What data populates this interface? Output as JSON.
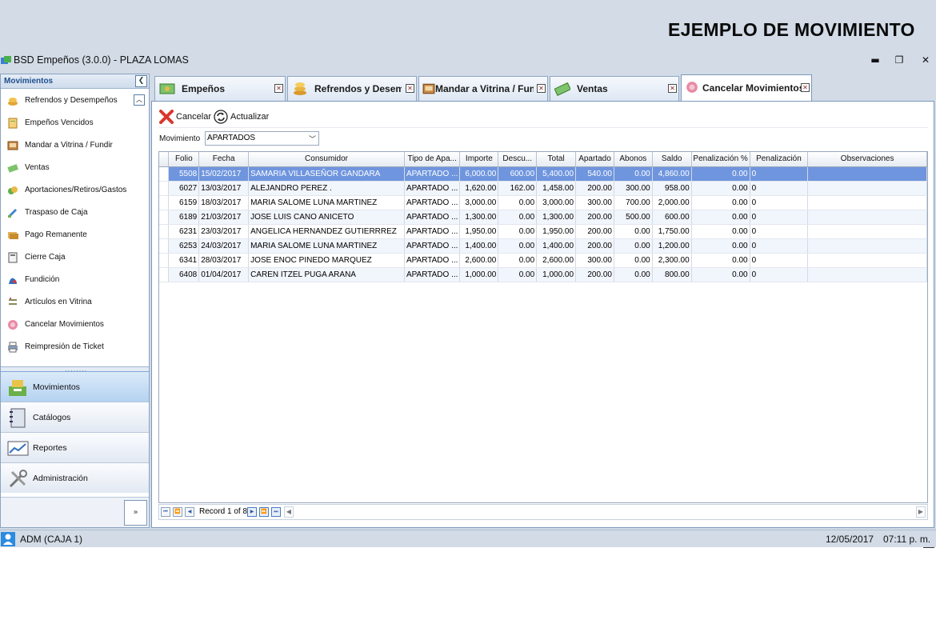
{
  "banner": {
    "title": "EJEMPLO DE MOVIMIENTO"
  },
  "window": {
    "title": "BSD Empeños (3.0.0) - PLAZA LOMAS",
    "minimize": "▬",
    "restore": "❐",
    "close": "✕"
  },
  "nav": {
    "header": "Movimientos",
    "items": [
      {
        "label": "Refrendos y Desempeños",
        "icon": "coins-icon"
      },
      {
        "label": "Empeños Vencidos",
        "icon": "document-icon"
      },
      {
        "label": "Mandar a Vitrina / Fundir",
        "icon": "showcase-icon"
      },
      {
        "label": "Ventas",
        "icon": "money-icon"
      },
      {
        "label": "Aportaciones/Retiros/Gastos",
        "icon": "coins-green-icon"
      },
      {
        "label": "Traspaso de Caja",
        "icon": "transfer-icon"
      },
      {
        "label": "Pago Remanente",
        "icon": "payment-icon"
      },
      {
        "label": "Cierre Caja",
        "icon": "calculator-icon"
      },
      {
        "label": "Fundición",
        "icon": "melt-icon"
      },
      {
        "label": "Artículos en Vitrina",
        "icon": "shelf-icon"
      },
      {
        "label": "Cancelar Movimientos",
        "icon": "cancel-pink-icon"
      },
      {
        "label": "Reimpresión de Ticket",
        "icon": "printer-icon"
      }
    ],
    "groups": [
      {
        "label": "Movimientos",
        "icon": "cash-register-icon"
      },
      {
        "label": "Catálogos",
        "icon": "notebook-icon"
      },
      {
        "label": "Reportes",
        "icon": "chart-report-icon"
      },
      {
        "label": "Administración",
        "icon": "tools-icon"
      }
    ]
  },
  "tabs": [
    {
      "label": "Empeños",
      "icon": "money-bills-icon"
    },
    {
      "label": "Refrendos y Desempeños",
      "icon": "coins-stack-icon"
    },
    {
      "label": "Mandar a Vitrina / Fundir",
      "icon": "showcase-icon"
    },
    {
      "label": "Ventas",
      "icon": "cash-green-icon"
    },
    {
      "label": "Cancelar Movimientos",
      "icon": "cancel-pink-icon"
    }
  ],
  "toolbar": {
    "cancel_label": "Cancelar",
    "refresh_label": "Actualizar"
  },
  "filter": {
    "label": "Movimiento",
    "value": "APARTADOS"
  },
  "grid": {
    "columns": [
      "Folio",
      "Fecha",
      "Consumidor",
      "Tipo de Apa...",
      "Importe",
      "Descu...",
      "Total",
      "Apartado",
      "Abonos",
      "Saldo",
      "Penalización %",
      "Penalización",
      "Observaciones"
    ],
    "rows": [
      [
        "5508",
        "15/02/2017",
        "SAMARIA VILLASEÑOR GANDARA",
        "APARTADO ...",
        "6,000.00",
        "600.00",
        "5,400.00",
        "540.00",
        "0.00",
        "4,860.00",
        "0.00",
        "0",
        ""
      ],
      [
        "6027",
        "13/03/2017",
        "ALEJANDRO PEREZ .",
        "APARTADO ...",
        "1,620.00",
        "162.00",
        "1,458.00",
        "200.00",
        "300.00",
        "958.00",
        "0.00",
        "0",
        ""
      ],
      [
        "6159",
        "18/03/2017",
        "MARIA SALOME LUNA MARTINEZ",
        "APARTADO ...",
        "3,000.00",
        "0.00",
        "3,000.00",
        "300.00",
        "700.00",
        "2,000.00",
        "0.00",
        "0",
        ""
      ],
      [
        "6189",
        "21/03/2017",
        "JOSE LUIS CANO ANICETO",
        "APARTADO ...",
        "1,300.00",
        "0.00",
        "1,300.00",
        "200.00",
        "500.00",
        "600.00",
        "0.00",
        "0",
        ""
      ],
      [
        "6231",
        "23/03/2017",
        "ANGELICA HERNANDEZ GUTIERRREZ",
        "APARTADO ...",
        "1,950.00",
        "0.00",
        "1,950.00",
        "200.00",
        "0.00",
        "1,750.00",
        "0.00",
        "0",
        ""
      ],
      [
        "6253",
        "24/03/2017",
        "MARIA SALOME LUNA MARTINEZ",
        "APARTADO ...",
        "1,400.00",
        "0.00",
        "1,400.00",
        "200.00",
        "0.00",
        "1,200.00",
        "0.00",
        "0",
        ""
      ],
      [
        "6341",
        "28/03/2017",
        "JOSE ENOC PINEDO MARQUEZ",
        "APARTADO ...",
        "2,600.00",
        "0.00",
        "2,600.00",
        "300.00",
        "0.00",
        "2,300.00",
        "0.00",
        "0",
        ""
      ],
      [
        "6408",
        "01/04/2017",
        "CAREN ITZEL PUGA ARANA",
        "APARTADO ...",
        "1,000.00",
        "0.00",
        "1,000.00",
        "200.00",
        "0.00",
        "800.00",
        "0.00",
        "0",
        ""
      ]
    ],
    "record_text": "Record 1 of 8"
  },
  "status": {
    "user": "ADM (CAJA 1)",
    "date": "12/05/2017",
    "time": "07:11 p. m."
  },
  "colors": {
    "chrome": "#d2dbe6",
    "selection": "#6f95de",
    "accent_border": "#7c98bd"
  }
}
